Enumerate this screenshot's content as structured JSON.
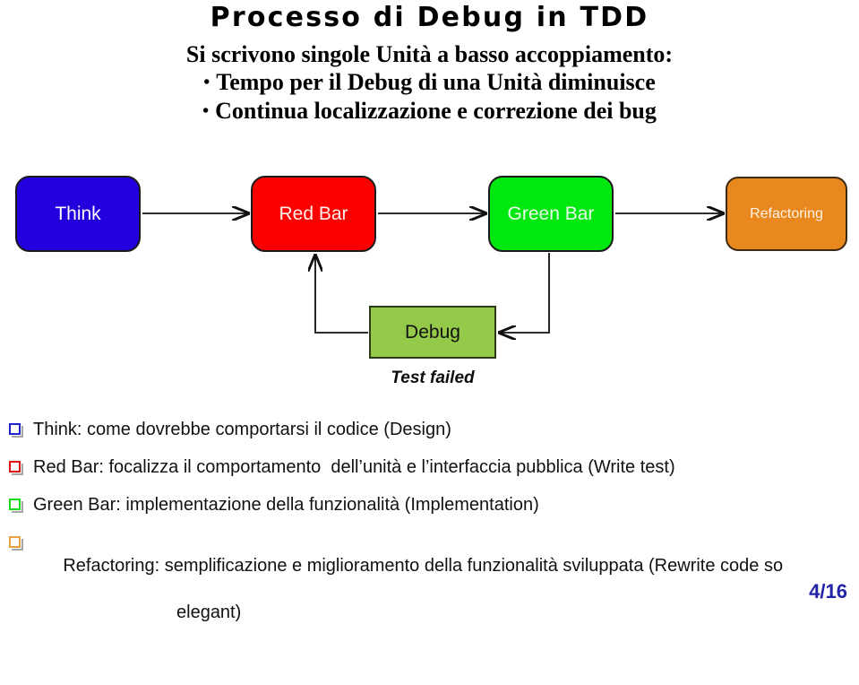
{
  "slide": {
    "title": "Processo di Debug in TDD",
    "page_number": "4/16",
    "page_number_color": "#2323a8"
  },
  "subtitle": {
    "line1": "Si scrivono singole Unità a basso accoppiamento:",
    "line2": "Tempo per il Debug di una Unità diminuisce",
    "line3": "Continua localizzazione e correzione dei bug"
  },
  "diagram": {
    "type": "flow",
    "nodes": [
      {
        "id": "think",
        "label": "Think",
        "color": "#2200dd",
        "text_color": "#ffffff"
      },
      {
        "id": "red_bar",
        "label": "Red Bar",
        "color": "#fb0000",
        "text_color": "#fdf0ea"
      },
      {
        "id": "green_bar",
        "label": "Green Bar",
        "color": "#00e810",
        "text_color": "#eafaea"
      },
      {
        "id": "refactoring",
        "label": "Refactoring",
        "color": "#e8881e",
        "text_color": "#fdf3e6"
      },
      {
        "id": "debug",
        "label": "Debug",
        "color": "#94c94a",
        "text_color": "#111111"
      }
    ],
    "edge_label": "Test failed",
    "edges": [
      {
        "from": "think",
        "to": "red_bar"
      },
      {
        "from": "red_bar",
        "to": "green_bar"
      },
      {
        "from": "green_bar",
        "to": "refactoring"
      },
      {
        "from": "green_bar",
        "to": "debug"
      },
      {
        "from": "debug",
        "to": "red_bar"
      }
    ]
  },
  "bullets": [
    {
      "marker_color": "#2222cc",
      "text": "Think: come dovrebbe comportarsi il codice (Design)",
      "continuation": ""
    },
    {
      "marker_color": "#e01010",
      "text": "Red Bar: focalizza il comportamento  dell’unità e l’interfaccia pubblica (Write test)",
      "continuation": ""
    },
    {
      "marker_color": "#14dd14",
      "text": "Green Bar: implementazione della funzionalità (Implementation)",
      "continuation": ""
    },
    {
      "marker_color": "#e8a040",
      "text": "Refactoring: semplificazione e miglioramento della funzionalità sviluppata (Rewrite code so",
      "continuation": "elegant)"
    }
  ]
}
